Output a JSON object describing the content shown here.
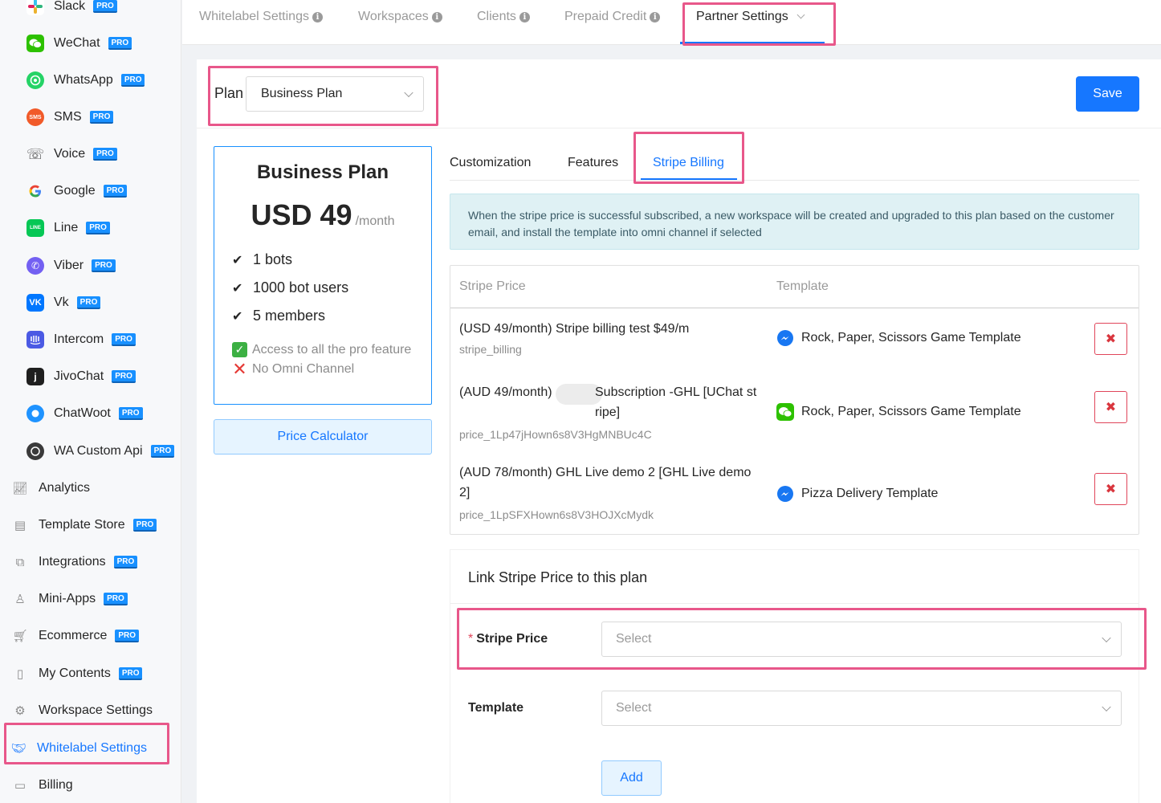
{
  "sidebar": {
    "items": [
      {
        "label": "Slack",
        "pro": "PRO",
        "icon": "slack-icon"
      },
      {
        "label": "WeChat",
        "pro": "PRO",
        "icon": "wechat-icon"
      },
      {
        "label": "WhatsApp",
        "pro": "PRO",
        "icon": "whatsapp-icon"
      },
      {
        "label": "SMS",
        "pro": "PRO",
        "icon": "sms-icon"
      },
      {
        "label": "Voice",
        "pro": "PRO",
        "icon": "voice-icon"
      },
      {
        "label": "Google",
        "pro": "PRO",
        "icon": "google-icon"
      },
      {
        "label": "Line",
        "pro": "PRO",
        "icon": "line-icon"
      },
      {
        "label": "Viber",
        "pro": "PRO",
        "icon": "viber-icon"
      },
      {
        "label": "Vk",
        "pro": "PRO",
        "icon": "vk-icon"
      },
      {
        "label": "Intercom",
        "pro": "PRO",
        "icon": "intercom-icon"
      },
      {
        "label": "JivoChat",
        "pro": "PRO",
        "icon": "jivochat-icon"
      },
      {
        "label": "ChatWoot",
        "pro": "PRO",
        "icon": "chatwoot-icon"
      },
      {
        "label": "WA Custom Api",
        "pro": "PRO",
        "icon": "wa-custom-api-icon"
      },
      {
        "label": "Analytics",
        "pro": "",
        "icon": "analytics-icon"
      },
      {
        "label": "Template Store",
        "pro": "PRO",
        "icon": "template-store-icon"
      },
      {
        "label": "Integrations",
        "pro": "PRO",
        "icon": "integrations-icon"
      },
      {
        "label": "Mini-Apps",
        "pro": "PRO",
        "icon": "mini-apps-icon"
      },
      {
        "label": "Ecommerce",
        "pro": "PRO",
        "icon": "cart-icon"
      },
      {
        "label": "My Contents",
        "pro": "PRO",
        "icon": "contents-icon"
      },
      {
        "label": "Workspace Settings",
        "pro": "",
        "icon": "gear-icon"
      },
      {
        "label": "Whitelabel Settings",
        "pro": "",
        "icon": "handshake-icon"
      },
      {
        "label": "Billing",
        "pro": "",
        "icon": "billing-icon"
      }
    ],
    "active_color": "#1677ff"
  },
  "top_tabs": [
    {
      "label": "Whitelabel Settings"
    },
    {
      "label": "Workspaces"
    },
    {
      "label": "Clients"
    },
    {
      "label": "Prepaid Credit"
    },
    {
      "label": "Partner Settings"
    }
  ],
  "plan_bar": {
    "label": "Plan",
    "selected": "Business Plan",
    "save_label": "Save"
  },
  "plan_card": {
    "name": "Business Plan",
    "price": "USD 49",
    "period": "/month",
    "features": [
      "1 bots",
      "1000 bot users",
      "5 members"
    ],
    "extra": [
      "Access to all the pro feature",
      "No Omni Channel"
    ],
    "calc_label": "Price Calculator"
  },
  "inner_tabs": [
    "Customization",
    "Features",
    "Stripe Billing"
  ],
  "alert": "When the stripe price is successful subscribed, a new workspace will be created and upgraded to this plan based on the customer email, and install the template into omni channel if selected",
  "table": {
    "headers": [
      "Stripe Price",
      "Template"
    ],
    "rows": [
      {
        "title": "(USD 49/month) Stripe billing test $49/m",
        "sub": "stripe_billing",
        "template": "Rock, Paper, Scissors Game Template",
        "icon": "messenger-icon"
      },
      {
        "title": "(AUD 49/month)",
        "title2": "Subscription -GHL [UChat st ripe]",
        "sub": "price_1Lp47jHown6s8V3HgMNBUc4C",
        "template": "Rock, Paper, Scissors Game Template",
        "icon": "wechat-icon"
      },
      {
        "title": "(AUD 78/month) GHL Live demo 2 [GHL Live demo 2]",
        "sub": "price_1LpSFXHown6s8V3HOJXcMydk",
        "template": "Pizza Delivery Template",
        "icon": "messenger-icon"
      }
    ]
  },
  "link_section": {
    "title": "Link Stripe Price to this plan",
    "stripe_label": "Stripe Price",
    "stripe_placeholder": "Select",
    "template_label": "Template",
    "template_placeholder": "Select",
    "add_label": "Add"
  }
}
